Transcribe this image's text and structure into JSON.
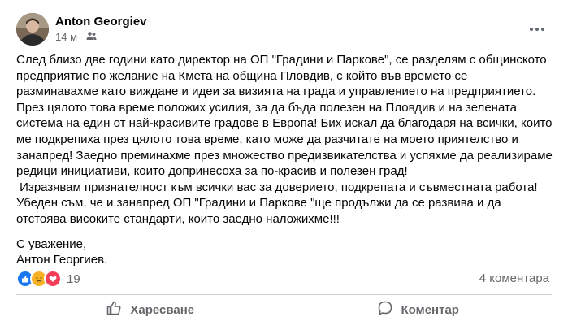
{
  "post": {
    "author": "Anton Georgiev",
    "time": "14 м",
    "separator": "·",
    "audience_icon": "friends-icon",
    "more_icon": "more-options-icon",
    "paragraphs": [
      "След близо две години като директор на ОП \"Градини и Паркове\", се разделям с общинското предприятие по желание на Кмета на община Пловдив, с който във времето се разминавахме като виждане и идеи за визията на града и управлението на предприятието. През цялото това време положих усилия, за да бъда полезен на Пловдив и на зелената система на един от най-красивите градове в Европа! Бих искал да благодаря на всички, които ме подкрепиха през цялото това време, като може да разчитате на моето приятелство и занапред! Заедно преминахме през множество предизвикателства и успяхме да реализираме редици инициативи, които допринесоха за по-красив и полезен град!\n Изразявам признателност към всички вас за доверието, подкрепата и съвместната работа!\nУбеден съм, че и занапред ОП \"Градини и Паркове \"ще продължи да се развива и да отстоява високите стандарти, които заедно наложихме!!!"
    ],
    "signature": [
      "С уважение,",
      "Антон Георгиев."
    ]
  },
  "stats": {
    "reactions": [
      "like-icon",
      "sad-icon",
      "love-icon"
    ],
    "reaction_count": "19",
    "comments": "4 коментара"
  },
  "actions": {
    "like_label": "Харесване",
    "comment_label": "Коментар",
    "like_icon": "thumbs-up-icon",
    "comment_icon": "comment-bubble-icon"
  },
  "colors": {
    "like": "#1877f2",
    "sad": "#f7b125",
    "love": "#f33e58",
    "secondary_text": "#65676b"
  }
}
